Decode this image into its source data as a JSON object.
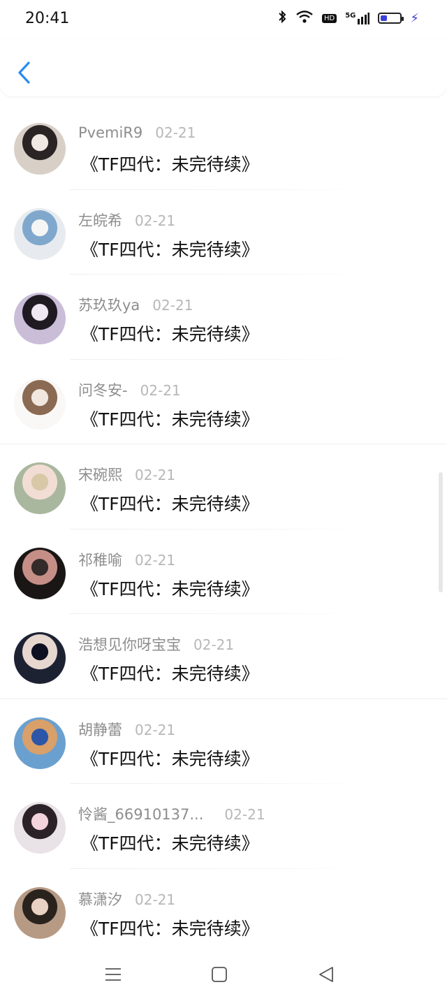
{
  "status_bar": {
    "time": "20:41",
    "network_label": "5G",
    "hd_label": "HD",
    "battery_level": 0.35,
    "colors": {
      "battery_fill": "#3b3fd9"
    }
  },
  "comments": [
    {
      "username": "PvemiR9",
      "date": "02-21",
      "text": "《TF四代：未完待续》",
      "avatar_colors": [
        "#d8cfc7",
        "#2b2424",
        "#f0e9e3"
      ]
    },
    {
      "username": "左皖希",
      "date": "02-21",
      "text": "《TF四代：未完待续》",
      "avatar_colors": [
        "#e7ebef",
        "#7fa8cc",
        "#f5f5f5"
      ]
    },
    {
      "username": "苏玖玖ya",
      "date": "02-21",
      "text": "《TF四代：未完待续》",
      "avatar_colors": [
        "#c9bdd8",
        "#1f1a22",
        "#efe7f2"
      ]
    },
    {
      "username": "问冬安-",
      "date": "02-21",
      "text": "《TF四代：未完待续》",
      "avatar_colors": [
        "#faf8f6",
        "#8a6a52",
        "#f2e7de"
      ]
    },
    {
      "username": "宋碗熙",
      "date": "02-21",
      "text": "《TF四代：未完待续》",
      "avatar_colors": [
        "#a9b79e",
        "#f2ddd4",
        "#d9c8a8"
      ]
    },
    {
      "username": "祁稚喻",
      "date": "02-21",
      "text": "《TF四代：未完待续》",
      "avatar_colors": [
        "#1a1616",
        "#c58f87",
        "#332a2a"
      ]
    },
    {
      "username": "浩想见你呀宝宝",
      "date": "02-21",
      "text": "《TF四代：未完待续》",
      "avatar_colors": [
        "#1d2233",
        "#e6d8cf",
        "#0d1020"
      ]
    },
    {
      "username": "胡静蕾",
      "date": "02-21",
      "text": "《TF四代：未完待续》",
      "avatar_colors": [
        "#6aa0cf",
        "#d9a06a",
        "#2d56a8"
      ]
    },
    {
      "username": "怜酱_66910137...",
      "date": "02-21",
      "text": "《TF四代：未完待续》",
      "avatar_colors": [
        "#e9e2e6",
        "#2a2226",
        "#f4d4dc"
      ]
    },
    {
      "username": "慕潇汐",
      "date": "02-21",
      "text": "《TF四代：未完待续》",
      "avatar_colors": [
        "#b69a84",
        "#2a221d",
        "#e9d1c3"
      ]
    }
  ],
  "colors": {
    "back_icon": "#2a8bf2",
    "username": "#8d8d8d",
    "date": "#b7b7b7",
    "content": "#111111"
  },
  "bottom_nav": {
    "icons": [
      "menu-icon",
      "home-icon",
      "back-triangle-icon"
    ]
  }
}
